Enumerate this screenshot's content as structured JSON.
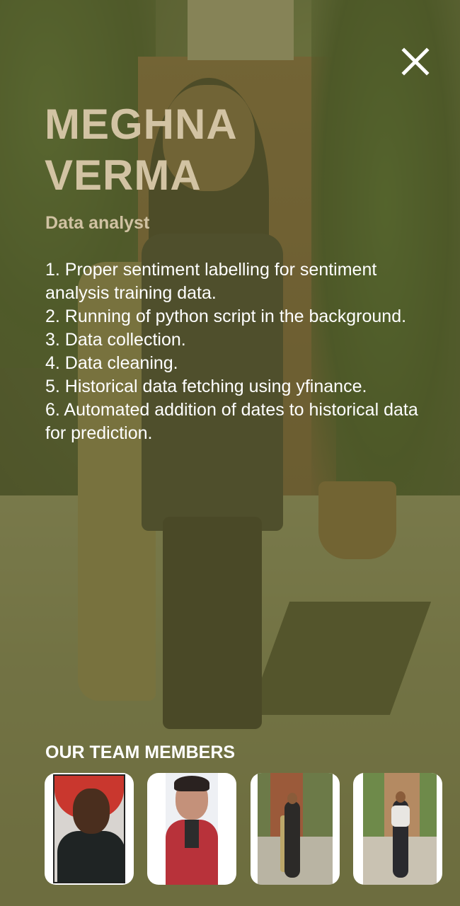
{
  "profile": {
    "name_line1": "MEGHNA",
    "name_line2": "VERMA",
    "role": "Data analyst",
    "tasks": [
      "1. Proper sentiment labelling for sentiment analysis training data.",
      "2. Running of python script in the background.",
      "3. Data collection.",
      "4. Data cleaning.",
      "5. Historical data fetching using yfinance.",
      "6. Automated addition of dates to historical data for prediction."
    ]
  },
  "close_icon": "close-icon",
  "team": {
    "heading": "OUR TEAM MEMBERS",
    "members": [
      {
        "icon": "member-photo"
      },
      {
        "icon": "member-photo"
      },
      {
        "icon": "member-photo"
      },
      {
        "icon": "member-photo"
      }
    ]
  },
  "colors": {
    "overlay": "#5c5f2d",
    "name_text": "#d2c3a3",
    "body_text": "#ffffff"
  }
}
